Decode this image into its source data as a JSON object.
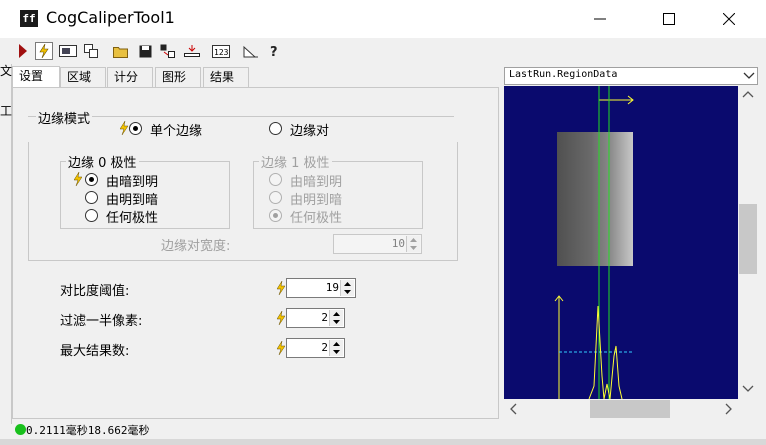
{
  "window": {
    "title": "CogCaliperTool1",
    "app_icon_text": "ff"
  },
  "toolbar": {
    "buttons": [
      "run-icon",
      "electric-icon",
      "display-icon",
      "copy-icon",
      "open-icon",
      "save-icon",
      "import-icon",
      "export-icon",
      "counter-icon",
      "scale-icon",
      "help-icon"
    ]
  },
  "left_strip": {
    "labels": [
      "文",
      "工"
    ]
  },
  "tabs": [
    {
      "label": "设置"
    },
    {
      "label": "区域"
    },
    {
      "label": "计分"
    },
    {
      "label": "图形"
    },
    {
      "label": "结果"
    }
  ],
  "edge_mode": {
    "title": "边缘模式",
    "single": "单个边缘",
    "pair": "边缘对",
    "selected": "single"
  },
  "edge0": {
    "title": "边缘 0 极性",
    "options": [
      "由暗到明",
      "由明到暗",
      "任何极性"
    ],
    "selected": 0
  },
  "edge1": {
    "title": "边缘 1 极性",
    "options": [
      "由暗到明",
      "由明到暗",
      "任何极性"
    ],
    "selected": 2
  },
  "pair_width": {
    "label": "边缘对宽度:",
    "value": "10"
  },
  "contrast": {
    "label": "对比度阈值:",
    "value": "19"
  },
  "filter": {
    "label": "过滤一半像素:",
    "value": "2"
  },
  "max_results": {
    "label": "最大结果数:",
    "value": "2"
  },
  "image": {
    "title": "LastRun.RegionData"
  },
  "status": {
    "text": "0.2111毫秒18.662毫秒",
    "color": "#18c01c"
  },
  "colors": {
    "display_bg": "#0a0a6e",
    "graphic": "#ffff33",
    "edge_line": "#22dd22",
    "threshold_line": "#33ccff"
  }
}
